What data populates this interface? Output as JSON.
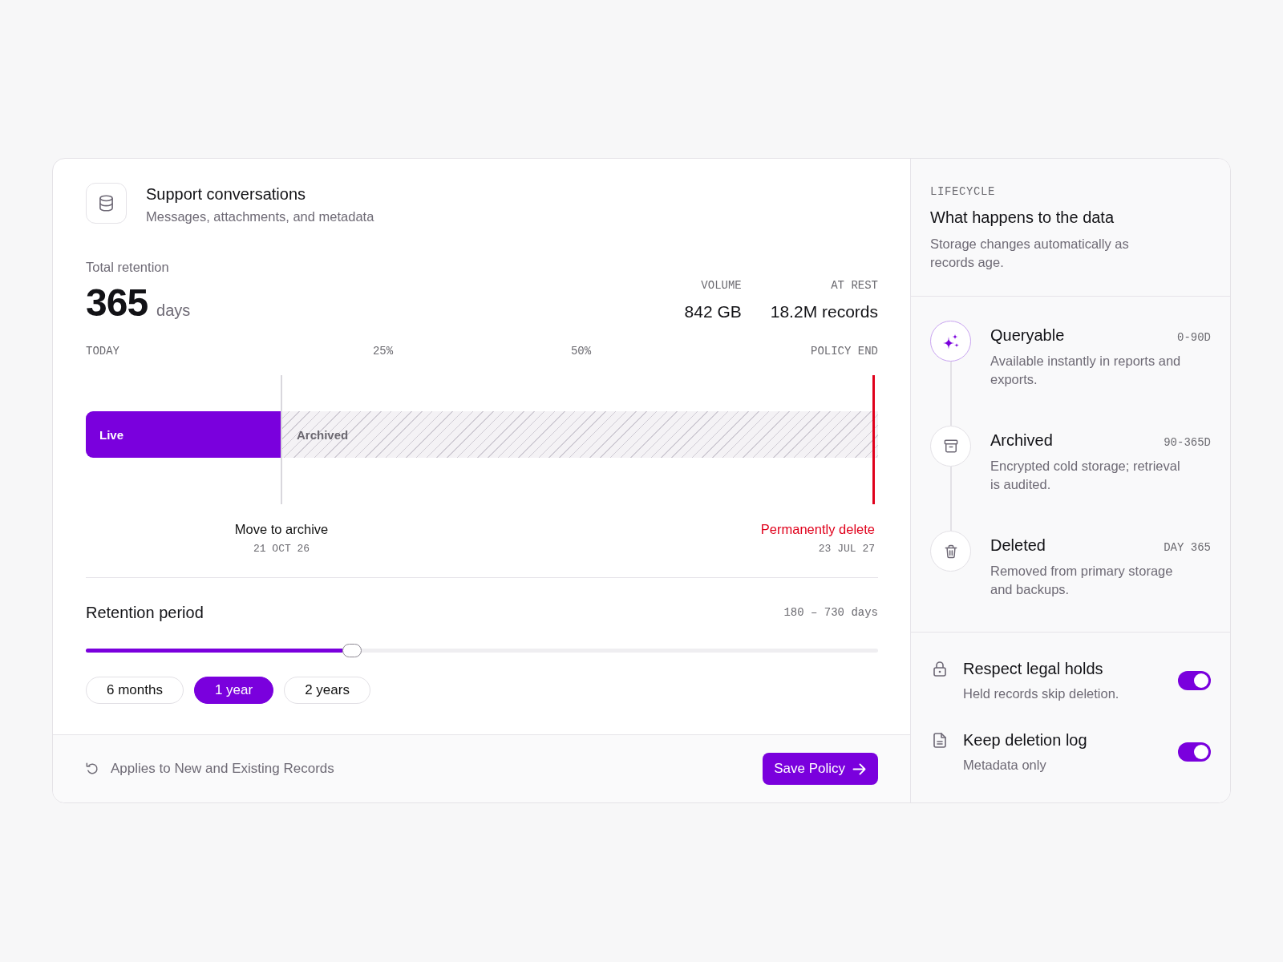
{
  "dataset": {
    "title": "Support conversations",
    "subtitle": "Messages, attachments, and metadata"
  },
  "total_retention": {
    "label": "Total retention",
    "value": "365",
    "unit": "days"
  },
  "stats": [
    {
      "label": "VOLUME",
      "value": "842 GB"
    },
    {
      "label": "AT REST",
      "value": "18.2M records"
    }
  ],
  "timeline": {
    "ticks": [
      "TODAY",
      "25%",
      "50%",
      "POLICY END"
    ],
    "segments": [
      {
        "kind": "live",
        "label": "Live",
        "level": 0.247
      },
      {
        "kind": "archived",
        "label": "Archived"
      }
    ],
    "markers": [
      {
        "kind": "archive",
        "label": "Move to archive",
        "date": "21 OCT 26"
      },
      {
        "kind": "delete",
        "label": "Permanently delete",
        "date": "23 JUL 27"
      }
    ]
  },
  "retention_period": {
    "title": "Retention period",
    "range": "180 – 730 days",
    "level": 0.336,
    "presets": [
      {
        "label": "6 months",
        "selected": false
      },
      {
        "label": "1 year",
        "selected": true
      },
      {
        "label": "2 years",
        "selected": false
      }
    ]
  },
  "footer": {
    "note": "Applies to New and Existing Records",
    "save_label": "Save Policy"
  },
  "lifecycle": {
    "eyebrow": "LIFECYCLE",
    "title": "What happens to the data",
    "description": "Storage changes automatically as records age.",
    "stages": [
      {
        "kind": "queryable",
        "title": "Queryable",
        "range": "0-90D",
        "description": "Available instantly in reports and exports.",
        "current": true
      },
      {
        "kind": "archived",
        "title": "Archived",
        "range": "90-365D",
        "description": "Encrypted cold storage; retrieval is audited.",
        "current": false
      },
      {
        "kind": "deleted",
        "title": "Deleted",
        "range": "DAY 365",
        "description": "Removed from primary storage and backups.",
        "current": false
      }
    ]
  },
  "settings": [
    {
      "kind": "lock",
      "title": "Respect legal holds",
      "description": "Held records skip deletion.",
      "on": true
    },
    {
      "kind": "document",
      "title": "Keep deletion log",
      "description": "Metadata only",
      "on": true
    }
  ]
}
